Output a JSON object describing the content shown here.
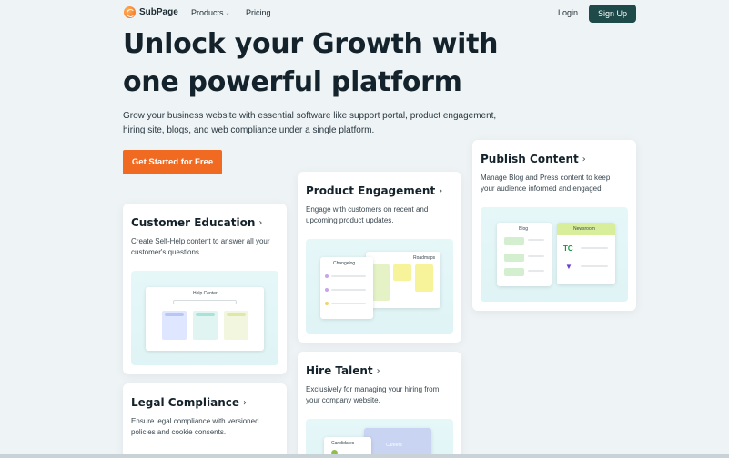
{
  "header": {
    "logo_text": "SubPage",
    "nav": [
      {
        "label": "Products",
        "has_dropdown": true
      },
      {
        "label": "Pricing",
        "has_dropdown": false
      }
    ],
    "login_label": "Login",
    "signup_label": "Sign Up"
  },
  "hero": {
    "title_line1": "Unlock your Growth with",
    "title_line2": "one powerful platform",
    "subtitle": "Grow your business website with essential software like support portal, product engagement, hiring site, blogs, and web compliance under a single platform.",
    "cta_label": "Get Started for Free"
  },
  "cards": {
    "education": {
      "title": "Customer Education",
      "description": "Create Self-Help content to answer all your customer's questions.",
      "illustration_label": "Help Center"
    },
    "product": {
      "title": "Product Engagement",
      "description": "Engage with customers on recent and upcoming product updates.",
      "illustration_labels": [
        "Changelog",
        "Roadmaps"
      ]
    },
    "publish": {
      "title": "Publish Content",
      "description": "Manage Blog and Press content to keep your audience informed and engaged.",
      "illustration_labels": [
        "Blog",
        "Newsroom"
      ]
    },
    "legal": {
      "title": "Legal Compliance",
      "description": "Ensure legal compliance with versioned policies and cookie consents."
    },
    "hire": {
      "title": "Hire Talent",
      "description": "Exclusively for managing your hiring from your company website.",
      "illustration_labels": [
        "Candidates",
        "Careers"
      ]
    }
  },
  "colors": {
    "accent": "#f06a22",
    "signup_bg": "#1f4a4a",
    "background": "#eef3f5"
  }
}
